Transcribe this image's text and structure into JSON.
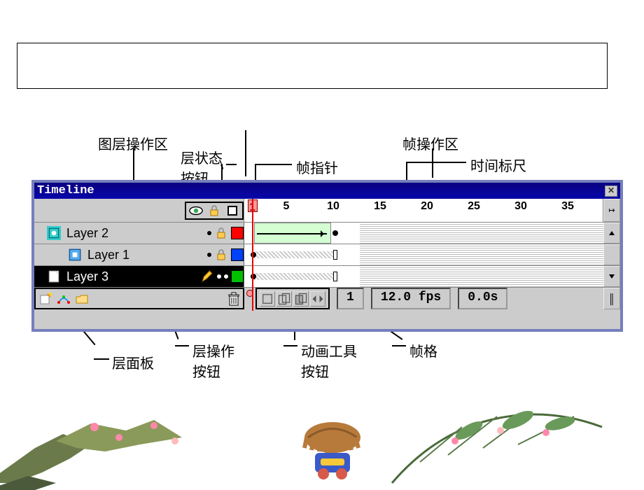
{
  "labels": {
    "layer_op_area": "图层操作区",
    "layer_status_btn": "层状态\n按钮",
    "frame_pointer": "帧指针",
    "frame_op_area": "帧操作区",
    "time_ruler": "时间标尺",
    "layer_panel": "层面板",
    "layer_op_btn": "层操作\n按钮",
    "anim_tool_btn": "动画工具\n按钮",
    "frame_cell": "帧格"
  },
  "window": {
    "title": "Timeline",
    "close": "✕"
  },
  "ruler": {
    "ticks": [
      1,
      5,
      10,
      15,
      20,
      25,
      30,
      35
    ],
    "playhead": 1
  },
  "layers": [
    {
      "name": "Layer 2",
      "indent": false,
      "selected": false,
      "icon": "mask",
      "locked": true,
      "color": "#ff0000",
      "tween": "shape"
    },
    {
      "name": "Layer 1",
      "indent": true,
      "selected": false,
      "icon": "page",
      "locked": true,
      "color": "#0040ff",
      "tween": "motion"
    },
    {
      "name": "Layer 3",
      "indent": false,
      "selected": true,
      "icon": "edit",
      "locked": false,
      "color": "#00c000",
      "tween": "motion2"
    }
  ],
  "status": {
    "frame": "1",
    "fps": "12.0 fps",
    "time": "0.0s"
  },
  "icons": {
    "eye": "eye-icon",
    "lock": "lock-icon",
    "square": "outline-square",
    "edge": "↔",
    "up": "▲",
    "down": "▼"
  }
}
